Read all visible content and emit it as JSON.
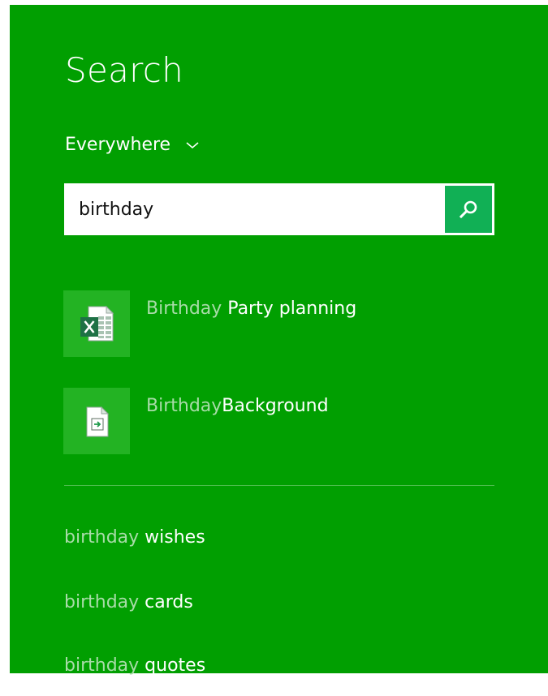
{
  "pane": {
    "title": "Search",
    "scope": {
      "label": "Everywhere",
      "icon": "chevron-down-icon"
    },
    "search": {
      "value": "birthday",
      "placeholder": "",
      "button_icon": "search-icon"
    }
  },
  "results": [
    {
      "prefix": "Birthday",
      "rest": " Party planning",
      "icon": "excel-file-icon"
    },
    {
      "prefix": "Birthday",
      "rest": "Background",
      "icon": "generic-file-icon"
    }
  ],
  "suggestions": [
    {
      "prefix": "birthday",
      "rest": " wishes"
    },
    {
      "prefix": "birthday",
      "rest": " cards"
    },
    {
      "prefix": "birthday",
      "rest": " quotes"
    }
  ],
  "colors": {
    "pane_background": "#019f01",
    "tile_background": "#23b323",
    "search_button": "#11b055",
    "dim_text": "#a8dca8"
  }
}
